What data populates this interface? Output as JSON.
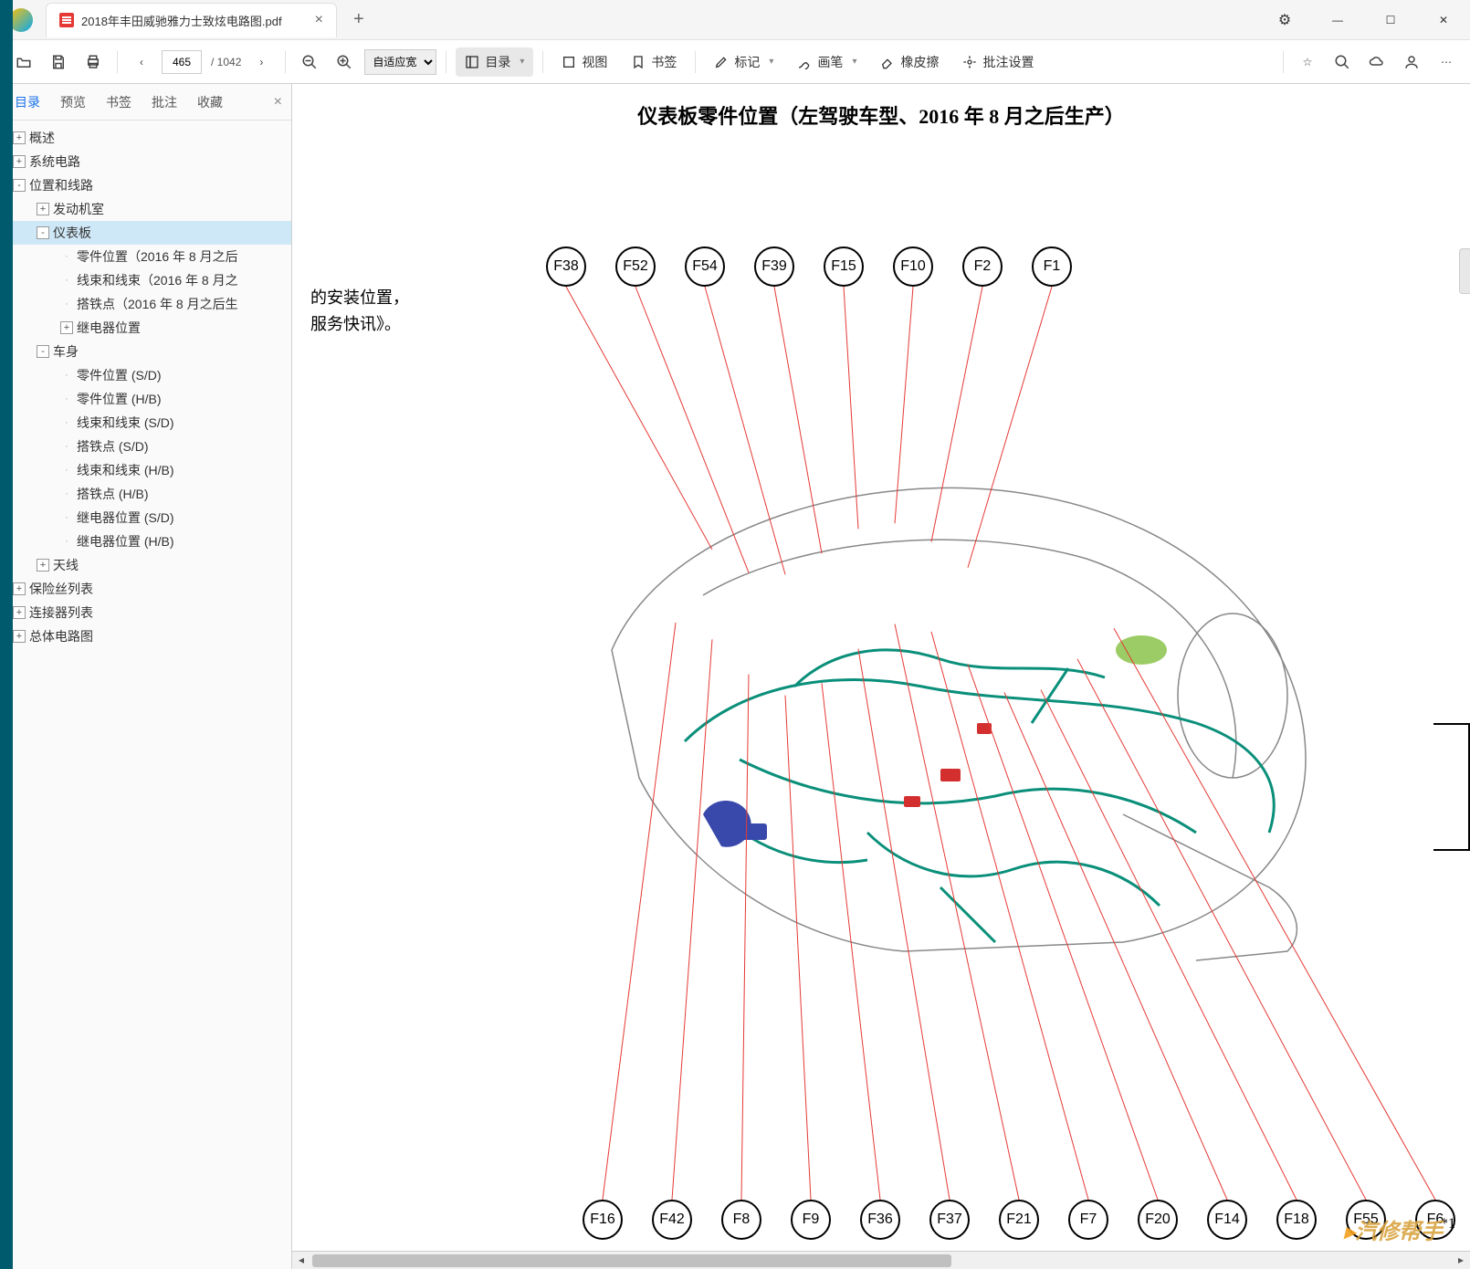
{
  "window": {
    "tab_title": "2018年丰田威驰雅力士致炫电路图.pdf",
    "controls": {
      "minimize": "—",
      "maximize": "☐",
      "close": "✕"
    }
  },
  "toolbar": {
    "page_current": "465",
    "page_total": "/ 1042",
    "zoom_mode": "自适应宽",
    "btn_outline": "目录",
    "btn_view": "视图",
    "btn_bookmark": "书签",
    "btn_mark": "标记",
    "btn_pen": "画笔",
    "btn_eraser": "橡皮擦",
    "btn_batch": "批注设置"
  },
  "side_tabs": [
    "目录",
    "预览",
    "书签",
    "批注",
    "收藏"
  ],
  "tree": [
    {
      "d": 0,
      "t": "+",
      "l": "概述"
    },
    {
      "d": 0,
      "t": "+",
      "l": "系统电路"
    },
    {
      "d": 0,
      "t": "-",
      "l": "位置和线路"
    },
    {
      "d": 1,
      "t": "+",
      "l": "发动机室"
    },
    {
      "d": 1,
      "t": "-",
      "l": "仪表板",
      "sel": true
    },
    {
      "d": 2,
      "t": "",
      "l": "零件位置（2016 年 8 月之后"
    },
    {
      "d": 2,
      "t": "",
      "l": "线束和线束（2016 年 8 月之"
    },
    {
      "d": 2,
      "t": "",
      "l": "搭铁点（2016 年 8 月之后生"
    },
    {
      "d": 2,
      "t": "+",
      "l": "继电器位置"
    },
    {
      "d": 1,
      "t": "-",
      "l": "车身"
    },
    {
      "d": 2,
      "t": "",
      "l": "零件位置 (S/D)"
    },
    {
      "d": 2,
      "t": "",
      "l": "零件位置 (H/B)"
    },
    {
      "d": 2,
      "t": "",
      "l": "线束和线束 (S/D)"
    },
    {
      "d": 2,
      "t": "",
      "l": "搭铁点 (S/D)"
    },
    {
      "d": 2,
      "t": "",
      "l": "线束和线束 (H/B)"
    },
    {
      "d": 2,
      "t": "",
      "l": "搭铁点 (H/B)"
    },
    {
      "d": 2,
      "t": "",
      "l": "继电器位置 (S/D)"
    },
    {
      "d": 2,
      "t": "",
      "l": "继电器位置 (H/B)"
    },
    {
      "d": 1,
      "t": "+",
      "l": "天线"
    },
    {
      "d": 0,
      "t": "+",
      "l": "保险丝列表"
    },
    {
      "d": 0,
      "t": "+",
      "l": "连接器列表"
    },
    {
      "d": 0,
      "t": "+",
      "l": "总体电路图"
    }
  ],
  "document": {
    "title": "仪表板零件位置（左驾驶车型、2016 年 8 月之后生产）",
    "note_line1": "的安装位置，",
    "note_line2": "服务快讯》。",
    "footer_note": "*1",
    "top_callouts": [
      "F38",
      "F52",
      "F54",
      "F39",
      "F15",
      "F10",
      "F2",
      "F1"
    ],
    "bottom_callouts": [
      "F16",
      "F42",
      "F8",
      "F9",
      "F36",
      "F37",
      "F21",
      "F7",
      "F20",
      "F14",
      "F18",
      "F55",
      "F6"
    ],
    "watermark": "汽修帮手"
  }
}
